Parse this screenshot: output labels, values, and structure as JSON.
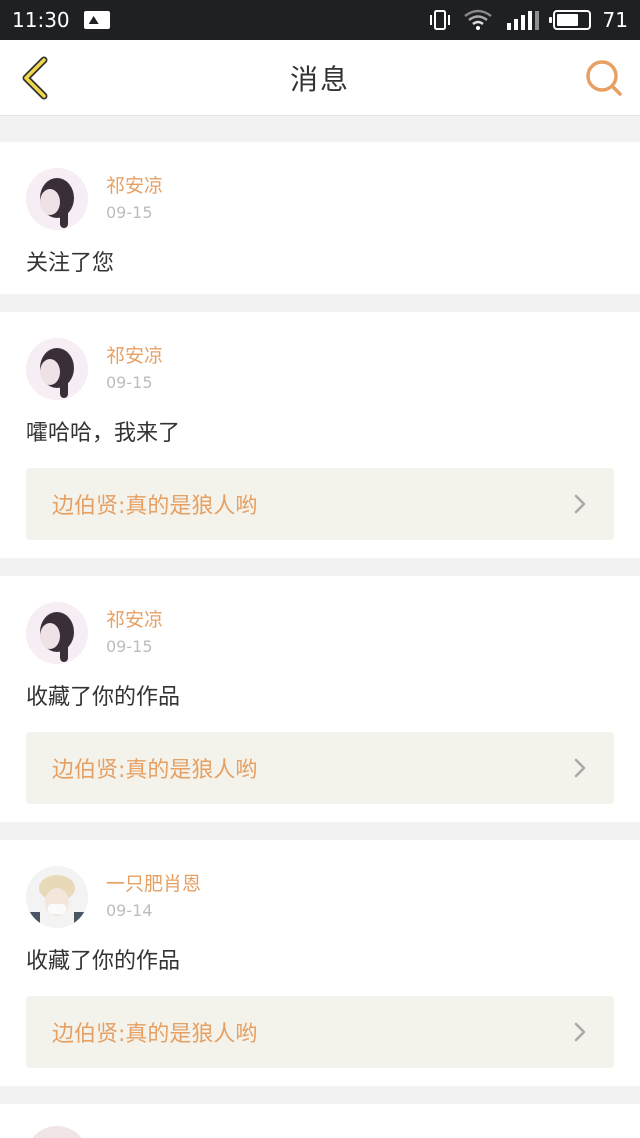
{
  "status_bar": {
    "time": "11:30",
    "battery": "71"
  },
  "header": {
    "title": "消息"
  },
  "messages": [
    {
      "user": "祁安凉",
      "date": "09-15",
      "text": "关注了您",
      "ref": ""
    },
    {
      "user": "祁安凉",
      "date": "09-15",
      "text": "嚯哈哈，我来了",
      "ref": "边伯贤:真的是狼人哟"
    },
    {
      "user": "祁安凉",
      "date": "09-15",
      "text": "收藏了你的作品",
      "ref": "边伯贤:真的是狼人哟"
    },
    {
      "user": "一只肥肖恩",
      "date": "09-14",
      "text": "收藏了你的作品",
      "ref": "边伯贤:真的是狼人哟"
    }
  ],
  "colors": {
    "accent": "#e6a064",
    "status_bar": "#1f2023",
    "ref_bg": "#f3f3ec"
  },
  "icons": {
    "back": "chevron-left-icon",
    "search": "search-icon",
    "ref_arrow": "chevron-right-icon"
  }
}
